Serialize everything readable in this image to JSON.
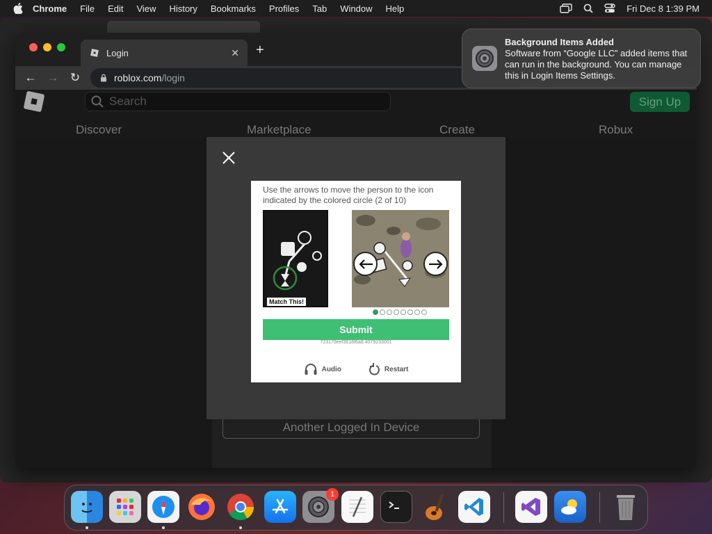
{
  "menubar": {
    "app_name": "Chrome",
    "items": [
      "File",
      "Edit",
      "View",
      "History",
      "Bookmarks",
      "Profiles",
      "Tab",
      "Window",
      "Help"
    ],
    "datetime": "Fri Dec 8  1:39 PM"
  },
  "browser": {
    "tab_title": "Login",
    "url_host": "roblox.com",
    "url_path": "/login"
  },
  "roblox": {
    "search_placeholder": "Search",
    "signup_label": "Sign Up",
    "nav": [
      "Discover",
      "Marketplace",
      "Create",
      "Robux"
    ],
    "another_device_label": "Another Logged In Device"
  },
  "captcha": {
    "instruction": "Use the arrows to move the person to the icon indicated by the colored circle (2 of 10)",
    "match_label": "Match This!",
    "submit_label": "Submit",
    "session_id": "723179eef3618f6a8.4079233001",
    "audio_label": "Audio",
    "restart_label": "Restart",
    "progress_total": 8,
    "progress_active": 1
  },
  "notification": {
    "title": "Background Items Added",
    "body": "Software from “Google LLC” added items that can run in the background. You can manage this in Login Items Settings."
  },
  "dock": {
    "apps": [
      "finder",
      "launchpad",
      "safari",
      "firefox",
      "chrome",
      "app-store",
      "system-settings",
      "textedit",
      "terminal",
      "garageband",
      "vscode",
      "visual-studio",
      "weather",
      "trash"
    ],
    "settings_badge": "1"
  },
  "colors": {
    "submit_green": "#3fbf74",
    "signup_green": "#0f5a33",
    "badge_red": "#ff3b30"
  }
}
